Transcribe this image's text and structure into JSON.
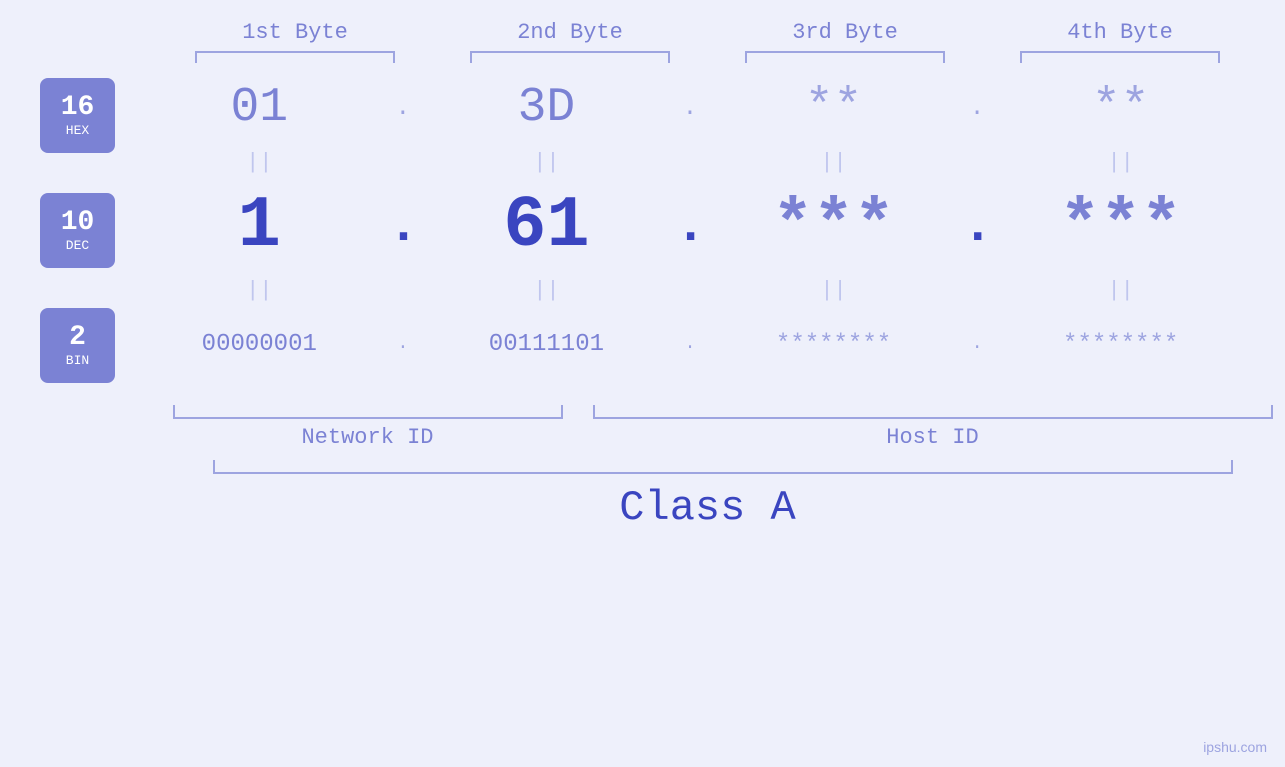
{
  "header": {
    "byte1": "1st Byte",
    "byte2": "2nd Byte",
    "byte3": "3rd Byte",
    "byte4": "4th Byte"
  },
  "badges": {
    "hex": {
      "number": "16",
      "label": "HEX"
    },
    "dec": {
      "number": "10",
      "label": "DEC"
    },
    "bin": {
      "number": "2",
      "label": "BIN"
    }
  },
  "hex_row": {
    "b1": "01",
    "b2": "3D",
    "b3": "**",
    "b4": "**",
    "dot": "."
  },
  "dec_row": {
    "b1": "1",
    "b2": "61",
    "b3": "***",
    "b4": "***",
    "dot": "."
  },
  "bin_row": {
    "b1": "00000001",
    "b2": "00111101",
    "b3": "********",
    "b4": "********",
    "dot": "."
  },
  "labels": {
    "network_id": "Network ID",
    "host_id": "Host ID",
    "class": "Class A"
  },
  "watermark": "ipshu.com"
}
